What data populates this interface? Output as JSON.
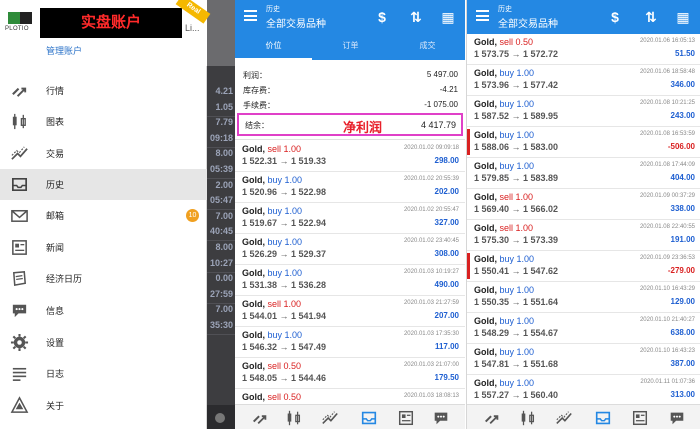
{
  "drawer": {
    "broker_name": "PLOTIO",
    "account_banner": "实盘账户",
    "account_name_tail": "Li...",
    "ribbon": "Real",
    "manage_accounts": "管理账户",
    "menu": [
      {
        "label": "行情",
        "icon": "quotes-icon"
      },
      {
        "label": "图表",
        "icon": "candlestick-chart-icon"
      },
      {
        "label": "交易",
        "icon": "trade-chart-icon"
      },
      {
        "label": "历史",
        "icon": "inbox-tray-icon",
        "active": true
      },
      {
        "label": "邮箱",
        "icon": "mail-icon",
        "badge": "10"
      },
      {
        "label": "新闻",
        "icon": "news-icon"
      },
      {
        "label": "经济日历",
        "icon": "calendar-icon"
      },
      {
        "label": "信息",
        "icon": "chat-bubble-icon"
      },
      {
        "label": "设置",
        "icon": "gear-icon"
      },
      {
        "label": "日志",
        "icon": "journal-icon"
      },
      {
        "label": "关于",
        "icon": "about-icon"
      }
    ],
    "peek_values": [
      "4.21",
      "1.05",
      "7.79",
      "09:18",
      "8.00",
      "05:39",
      "2.00",
      "05:47",
      "7.00",
      "40:45",
      "8.00",
      "10:27",
      "0.00",
      "27:59",
      "7.00",
      "35:30"
    ]
  },
  "history_left": {
    "subtitle": "历史",
    "title": "全部交易品种",
    "tabs": [
      "价位",
      "订单",
      "成交"
    ],
    "summary": [
      {
        "label": "利润：",
        "value": "5 497.00"
      },
      {
        "label": "库存费：",
        "value": "-4.21"
      },
      {
        "label": "手续费：",
        "value": "-1 075.00"
      }
    ],
    "balance": {
      "label": "结余：",
      "value": "4 417.79",
      "annotation": "净利润"
    },
    "trades": [
      {
        "symbol": "Gold,",
        "side": "sell",
        "lots": "1.00",
        "prices": "1 522.31 → 1 519.33",
        "time": "2020.01.02 09:09:18",
        "profit": "298.00"
      },
      {
        "symbol": "Gold,",
        "side": "buy",
        "lots": "1.00",
        "prices": "1 520.96 → 1 522.98",
        "time": "2020.01.02 20:55:39",
        "profit": "202.00"
      },
      {
        "symbol": "Gold,",
        "side": "buy",
        "lots": "1.00",
        "prices": "1 519.67 → 1 522.94",
        "time": "2020.01.02 20:55:47",
        "profit": "327.00"
      },
      {
        "symbol": "Gold,",
        "side": "buy",
        "lots": "1.00",
        "prices": "1 526.29 → 1 529.37",
        "time": "2020.01.02 23:40:45",
        "profit": "308.00"
      },
      {
        "symbol": "Gold,",
        "side": "buy",
        "lots": "1.00",
        "prices": "1 531.38 → 1 536.28",
        "time": "2020.01.03 10:19:27",
        "profit": "490.00"
      },
      {
        "symbol": "Gold,",
        "side": "sell",
        "lots": "1.00",
        "prices": "1 544.01 → 1 541.94",
        "time": "2020.01.03 21:27:59",
        "profit": "207.00"
      },
      {
        "symbol": "Gold,",
        "side": "buy",
        "lots": "1.00",
        "prices": "1 546.32 → 1 547.49",
        "time": "2020.01.03 17:35:30",
        "profit": "117.00"
      },
      {
        "symbol": "Gold,",
        "side": "sell",
        "lots": "0.50",
        "prices": "1 548.05 → 1 544.46",
        "time": "2020.01.03 21:07:00",
        "profit": "179.50"
      },
      {
        "symbol": "Gold,",
        "side": "sell",
        "lots": "0.50",
        "prices": "",
        "time": "2020.01.03 18:08:13",
        "profit": ""
      }
    ]
  },
  "history_right": {
    "subtitle": "历史",
    "title": "全部交易品种",
    "trades": [
      {
        "symbol": "Gold,",
        "side": "sell",
        "lots": "0.50",
        "prices": "1 573.75 → 1 572.72",
        "time": "2020.01.06 16:05:13",
        "profit": "51.50"
      },
      {
        "symbol": "Gold,",
        "side": "buy",
        "lots": "1.00",
        "prices": "1 573.96 → 1 577.42",
        "time": "2020.01.06 18:58:48",
        "profit": "346.00"
      },
      {
        "symbol": "Gold,",
        "side": "buy",
        "lots": "1.00",
        "prices": "1 587.52 → 1 589.95",
        "time": "2020.01.08 10:21:25",
        "profit": "243.00"
      },
      {
        "symbol": "Gold,",
        "side": "buy",
        "lots": "1.00",
        "prices": "1 588.06 → 1 583.00",
        "time": "2020.01.08 16:53:59",
        "profit": "-506.00",
        "negative": true
      },
      {
        "symbol": "Gold,",
        "side": "buy",
        "lots": "1.00",
        "prices": "1 579.85 → 1 583.89",
        "time": "2020.01.08 17:44:09",
        "profit": "404.00"
      },
      {
        "symbol": "Gold,",
        "side": "sell",
        "lots": "1.00",
        "prices": "1 569.40 → 1 566.02",
        "time": "2020.01.09 00:37:29",
        "profit": "338.00"
      },
      {
        "symbol": "Gold,",
        "side": "sell",
        "lots": "1.00",
        "prices": "1 575.30 → 1 573.39",
        "time": "2020.01.08 22:40:55",
        "profit": "191.00"
      },
      {
        "symbol": "Gold,",
        "side": "buy",
        "lots": "1.00",
        "prices": "1 550.41 → 1 547.62",
        "time": "2020.01.09 23:36:53",
        "profit": "-279.00",
        "negative": true
      },
      {
        "symbol": "Gold,",
        "side": "buy",
        "lots": "1.00",
        "prices": "1 550.35 → 1 551.64",
        "time": "2020.01.10 16:43:29",
        "profit": "129.00"
      },
      {
        "symbol": "Gold,",
        "side": "buy",
        "lots": "1.00",
        "prices": "1 548.29 → 1 554.67",
        "time": "2020.01.10 21:40:27",
        "profit": "638.00"
      },
      {
        "symbol": "Gold,",
        "side": "buy",
        "lots": "1.00",
        "prices": "1 547.81 → 1 551.68",
        "time": "2020.01.10 16:43:23",
        "profit": "387.00"
      },
      {
        "symbol": "Gold,",
        "side": "buy",
        "lots": "1.00",
        "prices": "1 557.27 → 1 560.40",
        "time": "2020.01.11 01:07:36",
        "profit": "313.00"
      }
    ]
  },
  "colors": {
    "appbar": "#2488e3",
    "buy": "#1e5fd1",
    "sell": "#d92121",
    "highlight_box": "#e040c8",
    "annotation": "#e8202a",
    "badge": "#f0a020"
  }
}
